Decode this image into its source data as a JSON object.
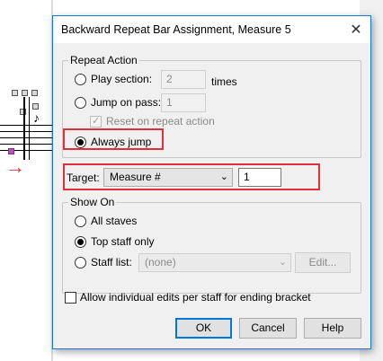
{
  "dialog": {
    "title": "Backward Repeat Bar Assignment, Measure 5",
    "close_glyph": "✕"
  },
  "repeat_action": {
    "group_label": "Repeat Action",
    "play_section_label": "Play section:",
    "play_section_value": "2",
    "times_label": "times",
    "jump_on_pass_label": "Jump on pass:",
    "jump_on_pass_value": "1",
    "reset_label": "Reset on repeat action",
    "always_jump_label": "Always jump",
    "selected": "always_jump"
  },
  "target": {
    "label": "Target:",
    "combo_value": "Measure #",
    "value": "1"
  },
  "show_on": {
    "group_label": "Show On",
    "all_staves_label": "All staves",
    "top_staff_only_label": "Top staff only",
    "staff_list_label": "Staff list:",
    "staff_list_value": "(none)",
    "edit_label": "Edit...",
    "selected": "top_staff_only"
  },
  "allow_edits_label": "Allow individual edits per staff for ending bracket",
  "buttons": {
    "ok": "OK",
    "cancel": "Cancel",
    "help": "Help"
  },
  "background": {
    "arrow_glyph": "→",
    "highlight_color": "#e0303a"
  }
}
